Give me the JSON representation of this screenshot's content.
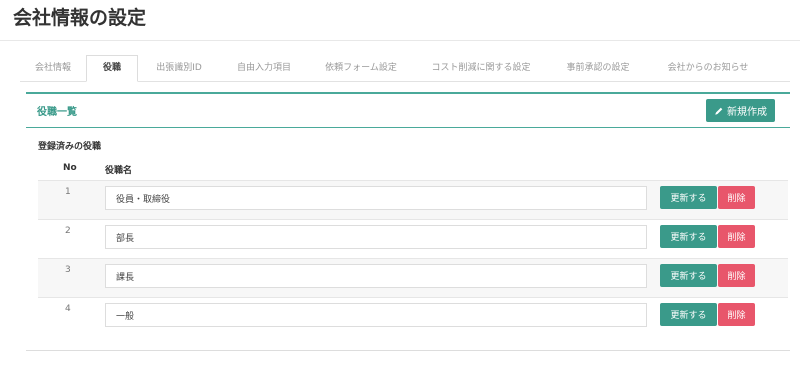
{
  "page": {
    "title": "会社情報の設定"
  },
  "tabs": [
    {
      "label": "会社情報"
    },
    {
      "label": "役職"
    },
    {
      "label": "出張識別ID"
    },
    {
      "label": "自由入力項目"
    },
    {
      "label": "依頼フォーム設定"
    },
    {
      "label": "コスト削減に関する設定"
    },
    {
      "label": "事前承認の設定"
    },
    {
      "label": "会社からのお知らせ"
    }
  ],
  "active_tab": "役職",
  "panel": {
    "title": "役職一覧",
    "new_button_label": "新規作成",
    "section_label": "登録済みの役職",
    "columns": {
      "no": "No",
      "name": "役職名"
    },
    "rows": [
      {
        "no": "1",
        "name": "役員・取締役",
        "update_label": "更新する",
        "delete_label": "削除"
      },
      {
        "no": "2",
        "name": "部長",
        "update_label": "更新する",
        "delete_label": "削除"
      },
      {
        "no": "3",
        "name": "課長",
        "update_label": "更新する",
        "delete_label": "削除"
      },
      {
        "no": "4",
        "name": "一般",
        "update_label": "更新する",
        "delete_label": "削除"
      }
    ]
  },
  "colors": {
    "accent": "#3a9a8a",
    "danger": "#e8566b"
  },
  "icons": {
    "new_button": "pencil-icon"
  }
}
